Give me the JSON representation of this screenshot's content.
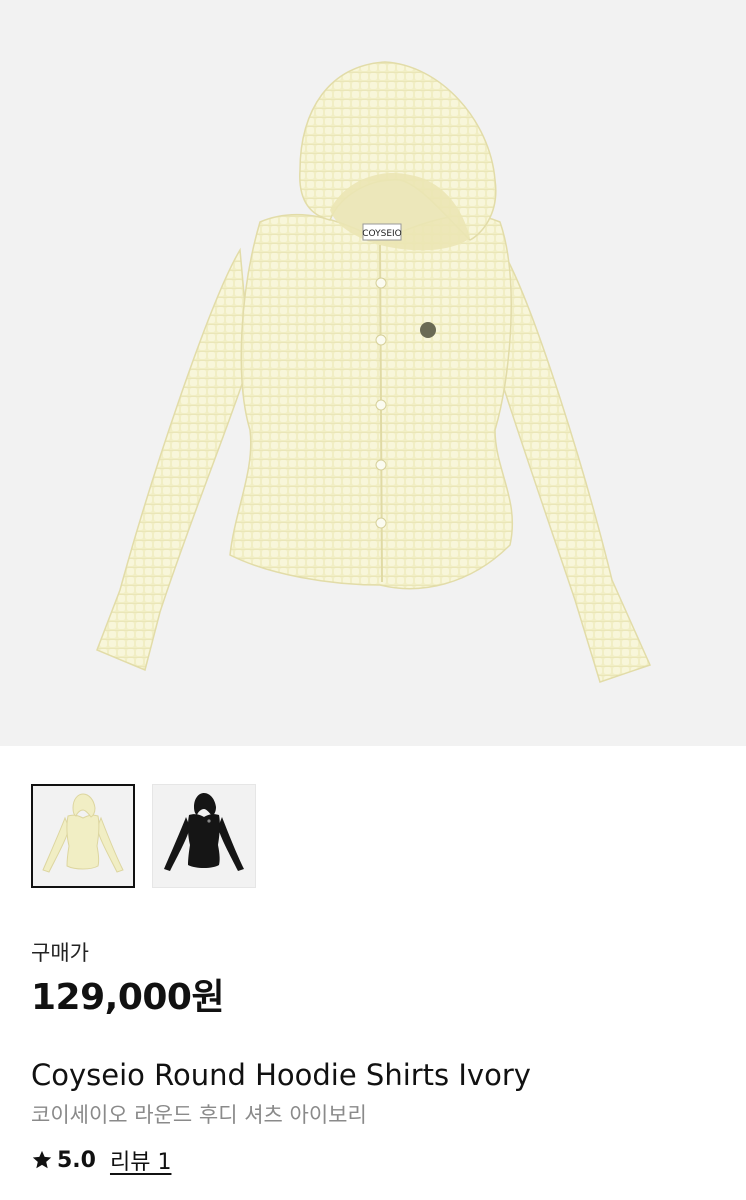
{
  "hero_image": {
    "label": "COYSEIO",
    "alt_icon": "ivory-hoodie-shirt-image"
  },
  "thumbnails": [
    {
      "name": "ivory",
      "color": "#f1eec4",
      "selected": true
    },
    {
      "name": "black",
      "color": "#151515",
      "selected": false
    }
  ],
  "price": {
    "label": "구매가",
    "value": "129,000원"
  },
  "product": {
    "title_en": "Coyseio Round Hoodie Shirts Ivory",
    "title_ko": "코이세이오 라운드 후디 셔츠 아이보리"
  },
  "rating": {
    "icon": "star-icon",
    "value": "5.0",
    "review_label": "리뷰 1"
  },
  "colors": {
    "background": "#f2f2f2",
    "garment_ivory": "#f1eec4",
    "garment_black": "#151515"
  }
}
